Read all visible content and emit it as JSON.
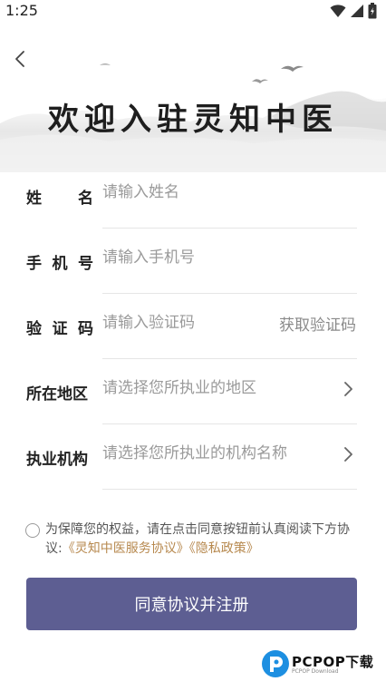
{
  "status_bar": {
    "time": "1:25"
  },
  "header": {
    "title": "欢迎入驻灵知中医"
  },
  "form": {
    "rows": [
      {
        "label": "姓名",
        "placeholder": "请输入姓名"
      },
      {
        "label": "手机号",
        "placeholder": "请输入手机号"
      },
      {
        "label": "验证码",
        "placeholder": "请输入验证码",
        "action": "获取验证码"
      },
      {
        "label": "所在地区",
        "placeholder": "请选择您所执业的地区"
      },
      {
        "label": "执业机构",
        "placeholder": "请选择您所执业的机构名称"
      }
    ]
  },
  "agreement": {
    "text": "为保障您的权益，请在点击同意按钮前认真阅读下方协议:",
    "links": [
      "《灵知中医服务协议》",
      "《隐私政策》"
    ]
  },
  "submit_label": "同意协议并注册",
  "watermark": {
    "brand": "PCPOP下载",
    "sub": "PCPOP Download"
  },
  "colors": {
    "primary": "#5d5e92",
    "link": "#b7894f",
    "placeholder": "#9a9a9a"
  }
}
